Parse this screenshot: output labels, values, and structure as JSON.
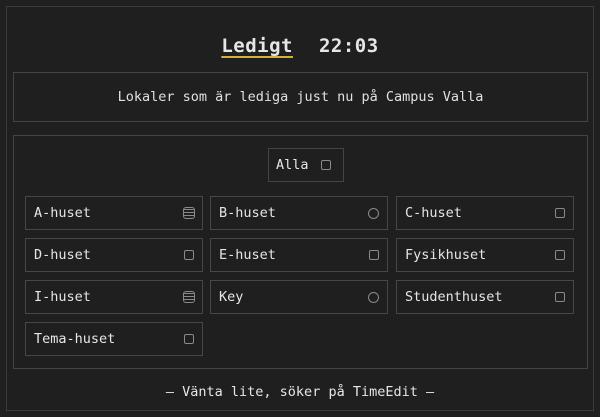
{
  "header": {
    "status": "Ledigt",
    "time": "22:03"
  },
  "subtitle": "Lokaler som är lediga just nu på Campus Valla",
  "filter": {
    "all_label": "Alla",
    "rooms": [
      {
        "label": "A-huset",
        "icon": "list-checkbox-icon"
      },
      {
        "label": "B-huset",
        "icon": "radio-circle-icon"
      },
      {
        "label": "C-huset",
        "icon": "checkbox-icon"
      },
      {
        "label": "D-huset",
        "icon": "checkbox-icon"
      },
      {
        "label": "E-huset",
        "icon": "checkbox-icon"
      },
      {
        "label": "Fysikhuset",
        "icon": "checkbox-icon"
      },
      {
        "label": "I-huset",
        "icon": "list-checkbox-icon"
      },
      {
        "label": "Key",
        "icon": "radio-circle-icon"
      },
      {
        "label": "Studenthuset",
        "icon": "checkbox-icon"
      },
      {
        "label": "Tema-huset",
        "icon": "checkbox-icon"
      }
    ]
  },
  "footer": "— Vänta lite, söker på TimeEdit —",
  "colors": {
    "background": "#1f1f1f",
    "border": "#444444",
    "accent_underline": "#d4b23a",
    "text": "#e6e6e6"
  }
}
